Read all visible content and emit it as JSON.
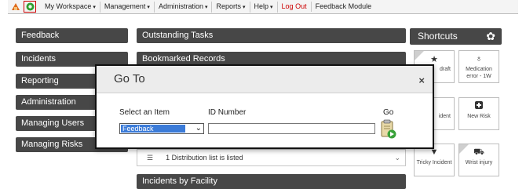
{
  "topbar": {
    "menu": [
      {
        "label": "My Workspace",
        "caret": "▾"
      },
      {
        "label": "Management",
        "caret": "▾"
      },
      {
        "label": "Administration",
        "caret": "▾"
      },
      {
        "label": "Reports",
        "caret": "▾"
      },
      {
        "label": "Help",
        "caret": "▾"
      },
      {
        "label": "Log Out",
        "caret": ""
      },
      {
        "label": "Feedback Module",
        "caret": ""
      }
    ]
  },
  "sidebar": {
    "items": [
      {
        "label": "Feedback"
      },
      {
        "label": "Incidents"
      },
      {
        "label": "Reporting"
      },
      {
        "label": "Administration"
      },
      {
        "label": "Managing Users"
      },
      {
        "label": "Managing Risks"
      }
    ]
  },
  "main": {
    "panels": {
      "outstanding": "Outstanding Tasks",
      "bookmarked": "Bookmarked Records",
      "distribution_text": "1 Distribution list is listed",
      "incidents_facility": "Incidents by Facility"
    }
  },
  "shortcuts": {
    "title": "Shortcuts",
    "tiles": [
      {
        "label": "draft",
        "icon": "star-icon"
      },
      {
        "label": "Medication error - 1W",
        "icon": "lightbulb-icon"
      },
      {
        "label": "ident",
        "icon": ""
      },
      {
        "label": "New Risk",
        "icon": "plus-icon"
      },
      {
        "label": "Tricky Incident",
        "icon": "down-arrow-icon"
      },
      {
        "label": "Wrist injury",
        "icon": "car-icon"
      }
    ]
  },
  "modal": {
    "title": "Go To",
    "close": "×",
    "select_label": "Select an Item",
    "select_value": "Feedback",
    "id_label": "ID Number",
    "id_value": "",
    "go_label": "Go"
  },
  "colors": {
    "nav_bg": "#474747",
    "select_highlight": "#3b7bd8",
    "logout": "#cc0000"
  }
}
